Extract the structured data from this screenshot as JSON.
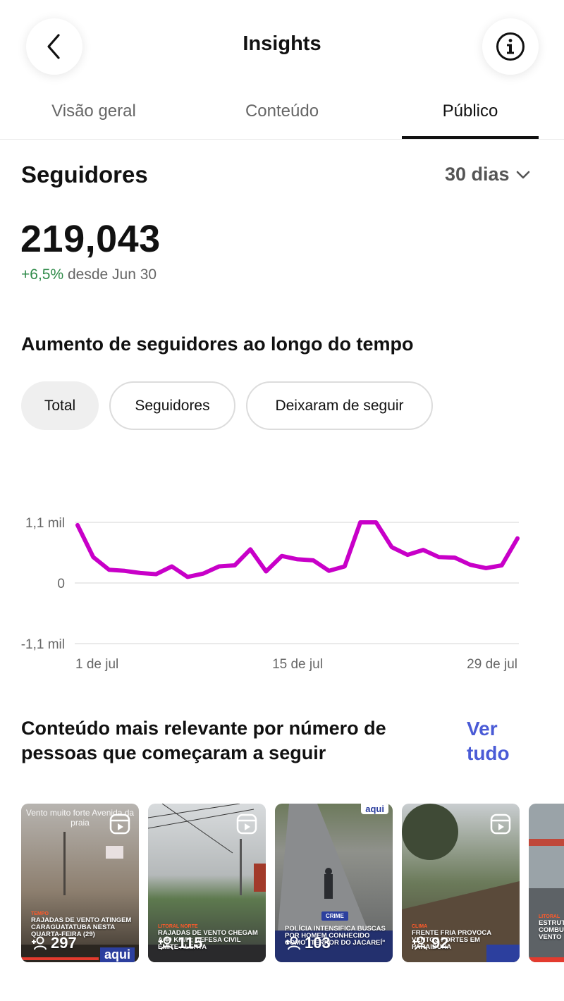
{
  "header": {
    "title": "Insights",
    "back_icon": "chevron-left-icon",
    "info_icon": "info-icon"
  },
  "tabs": [
    {
      "label": "Visão geral",
      "active": false
    },
    {
      "label": "Conteúdo",
      "active": false
    },
    {
      "label": "Público",
      "active": true
    }
  ],
  "followers": {
    "title": "Seguidores",
    "period": "30 dias",
    "total": "219,043",
    "delta": "+6,5%",
    "delta_suffix": "desde Jun 30"
  },
  "growth": {
    "title": "Aumento de seguidores ao longo do tempo",
    "filters": [
      "Total",
      "Seguidores",
      "Deixaram de seguir"
    ],
    "selected_filter": "Total"
  },
  "chart_data": {
    "type": "line",
    "color": "#c800c8",
    "y_tick_labels": [
      "1,1 mil",
      "0",
      "-1,1 mil"
    ],
    "y_ticks": [
      1100,
      0,
      -1100
    ],
    "ylim": [
      -1100,
      1100
    ],
    "x_tick_labels": [
      "1 de jul",
      "15 de jul",
      "29 de jul"
    ],
    "x_ticks": [
      1,
      15,
      29
    ],
    "xlim": [
      1,
      29
    ],
    "x": [
      1,
      2,
      3,
      4,
      5,
      6,
      7,
      8,
      9,
      10,
      11,
      12,
      13,
      14,
      15,
      16,
      17,
      18,
      19,
      20,
      21,
      22,
      23,
      24,
      25,
      26,
      27,
      28,
      29
    ],
    "values": [
      1050,
      470,
      240,
      220,
      180,
      160,
      300,
      110,
      170,
      300,
      320,
      610,
      210,
      490,
      430,
      410,
      220,
      300,
      1100,
      1100,
      650,
      510,
      600,
      470,
      460,
      330,
      270,
      320,
      810
    ],
    "grid": true
  },
  "content": {
    "title": "Conteúdo mais relevante por número de pessoas que começaram a seguir",
    "see_all": "Ver tudo",
    "items": [
      {
        "tag": "TEMPO",
        "caption": "RAJADAS DE VENTO ATINGEM CARAGUATATUBA NESTA QUARTA-FEIRA (29)",
        "count": "297",
        "overlay": "Vento muito forte Avenida da praia",
        "brand": "aqui"
      },
      {
        "tag": "LITORAL NORTE",
        "caption": "RAJADAS DE VENTO CHEGAM A 40 KM/H; DEFESA CIVIL EMITE ALERTA",
        "count": "115"
      },
      {
        "badge": "CRIME",
        "caption": "POLÍCIA INTENSIFICA BUSCAS POR HOMEM CONHECIDO COMO \"TERROR DO JACAREÍ\"",
        "count": "103",
        "brand": "aqui"
      },
      {
        "tag": "CLIMA",
        "caption": "FRENTE FRIA PROVOCA VENTOS FORTES EM PARAIBUNA",
        "count": "92"
      },
      {
        "tag": "LITORAL",
        "caption": "ESTRUTURA COMBUSTÍVEL POR VENTO",
        "count": ""
      }
    ]
  }
}
